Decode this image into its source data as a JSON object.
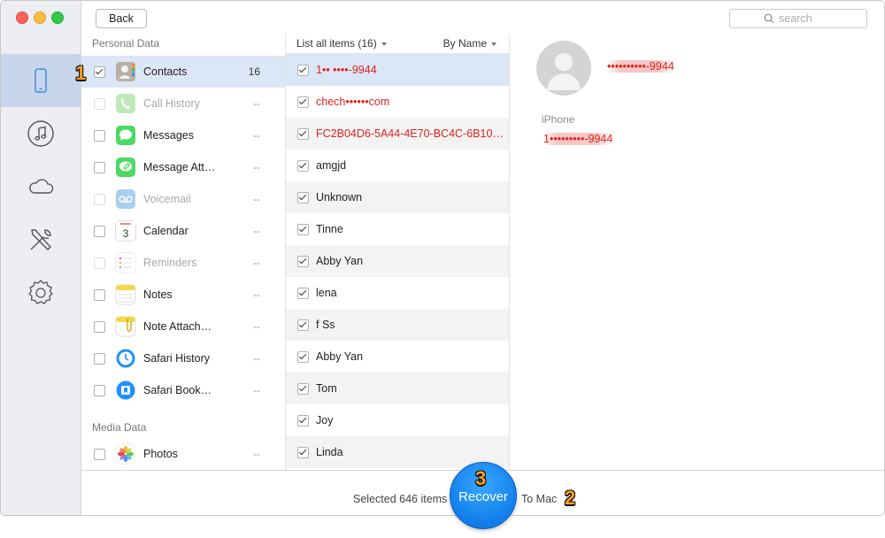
{
  "window": {
    "colors": {
      "close": "#fc605c",
      "minimize": "#fdbc40",
      "zoom": "#34c84a"
    }
  },
  "toolbar": {
    "back_label": "Back",
    "search_placeholder": "search"
  },
  "rail": {
    "items": [
      {
        "icon": "iphone-icon",
        "active": true
      },
      {
        "icon": "music-icon",
        "active": false
      },
      {
        "icon": "cloud-icon",
        "active": false
      },
      {
        "icon": "tools-icon",
        "active": false
      },
      {
        "icon": "settings-icon",
        "active": false
      }
    ]
  },
  "categories": {
    "personal_title": "Personal Data",
    "media_title": "Media Data",
    "items": [
      {
        "label": "Contacts",
        "count": "16",
        "checked": true,
        "disabled": false,
        "selected": true,
        "icon": "contacts-icon"
      },
      {
        "label": "Call History",
        "count": "--",
        "checked": false,
        "disabled": true,
        "icon": "phone-icon"
      },
      {
        "label": "Messages",
        "count": "--",
        "checked": false,
        "disabled": false,
        "icon": "messages-icon"
      },
      {
        "label": "Message Att…",
        "count": "--",
        "checked": false,
        "disabled": false,
        "icon": "message-attachment-icon"
      },
      {
        "label": "Voicemail",
        "count": "--",
        "checked": false,
        "disabled": true,
        "icon": "voicemail-icon"
      },
      {
        "label": "Calendar",
        "count": "--",
        "checked": false,
        "disabled": false,
        "icon": "calendar-icon",
        "calendar_day": "3"
      },
      {
        "label": "Reminders",
        "count": "--",
        "checked": false,
        "disabled": true,
        "icon": "reminders-icon"
      },
      {
        "label": "Notes",
        "count": "--",
        "checked": false,
        "disabled": false,
        "icon": "notes-icon"
      },
      {
        "label": "Note Attach…",
        "count": "--",
        "checked": false,
        "disabled": false,
        "icon": "note-attachment-icon"
      },
      {
        "label": "Safari History",
        "count": "--",
        "checked": false,
        "disabled": false,
        "icon": "safari-history-icon"
      },
      {
        "label": "Safari Book…",
        "count": "--",
        "checked": false,
        "disabled": false,
        "icon": "safari-bookmark-icon"
      }
    ],
    "media_items": [
      {
        "label": "Photos",
        "count": "--",
        "checked": false,
        "disabled": false,
        "icon": "photos-icon"
      }
    ]
  },
  "list": {
    "header_left": "List all items (16)",
    "header_right": "By Name",
    "items": [
      {
        "label": "1•• ••••-9944",
        "red": true,
        "checked": true,
        "selected": true
      },
      {
        "label": "chech••••••com",
        "red": true,
        "checked": true
      },
      {
        "label": "FC2B04D6-5A44-4E70-BC4C-6B100…",
        "red": true,
        "checked": true
      },
      {
        "label": "amgjd",
        "red": false,
        "checked": true
      },
      {
        "label": "Unknown",
        "red": false,
        "checked": true
      },
      {
        "label": "Tinne",
        "red": false,
        "checked": true
      },
      {
        "label": "Abby Yan",
        "red": false,
        "checked": true
      },
      {
        "label": "lena",
        "red": false,
        "checked": true
      },
      {
        "label": "f Ss",
        "red": false,
        "checked": true
      },
      {
        "label": "Abby Yan",
        "red": false,
        "checked": true
      },
      {
        "label": "Tom",
        "red": false,
        "checked": true
      },
      {
        "label": "Joy",
        "red": false,
        "checked": true
      },
      {
        "label": "Linda",
        "red": false,
        "checked": true
      }
    ]
  },
  "detail": {
    "name": "••••••••••-9944",
    "field_label": "iPhone",
    "field_value": "1•••••••••-9944",
    "accent_color": "#e0231c"
  },
  "footer": {
    "selected_text": "Selected 646 items",
    "recover_label": "Recover",
    "destination": "To Mac"
  },
  "steps": {
    "one": "1",
    "two": "2",
    "three": "3"
  }
}
